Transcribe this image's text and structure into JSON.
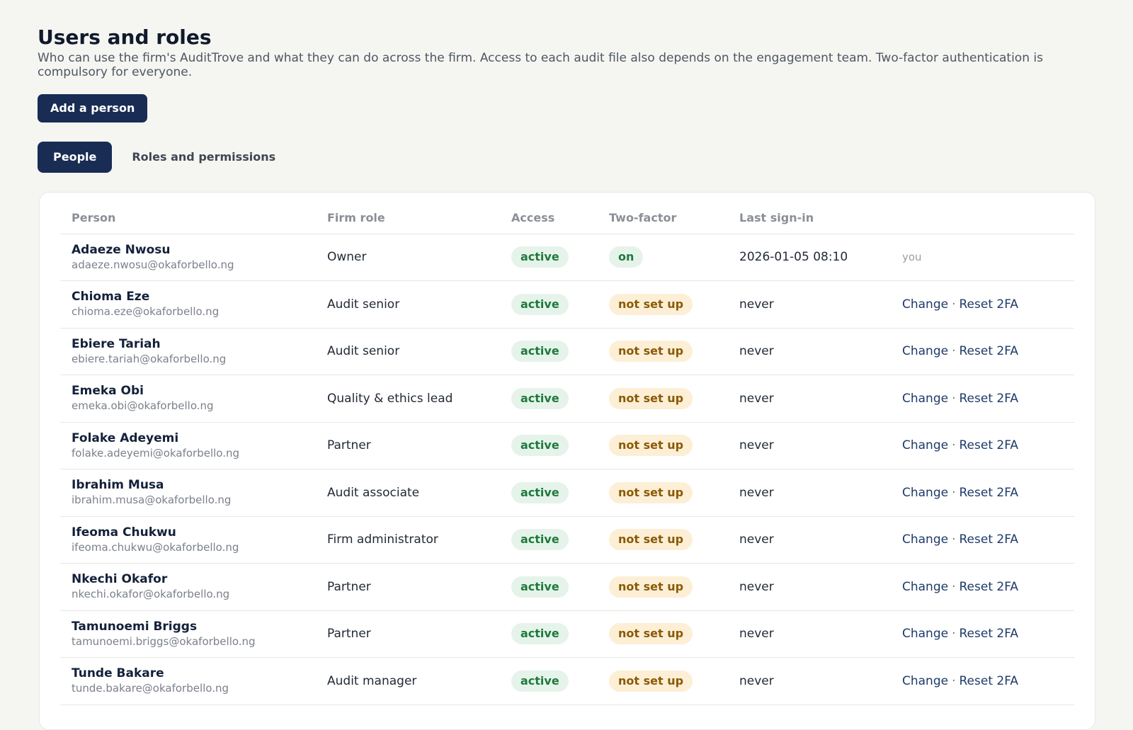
{
  "header": {
    "title": "Users and roles",
    "description": "Who can use the firm's AuditTrove and what they can do across the firm. Access to each audit file also depends on the engagement team. Two-factor authentication is compulsory for everyone.",
    "add_button": "Add a person"
  },
  "tabs": [
    {
      "label": "People",
      "active": true
    },
    {
      "label": "Roles and permissions",
      "active": false
    }
  ],
  "table": {
    "columns": [
      "Person",
      "Firm role",
      "Access",
      "Two-factor",
      "Last sign-in"
    ],
    "action_labels": {
      "change": "Change",
      "separator": "·",
      "reset": "Reset 2FA"
    },
    "rows": [
      {
        "name": "Adaeze Nwosu",
        "email": "adaeze.nwosu@okaforbello.ng",
        "role": "Owner",
        "access": "active",
        "two_factor": "on",
        "last_sign_in": "2026-01-05 08:10",
        "self_label": "you"
      },
      {
        "name": "Chioma Eze",
        "email": "chioma.eze@okaforbello.ng",
        "role": "Audit senior",
        "access": "active",
        "two_factor": "not set up",
        "last_sign_in": "never"
      },
      {
        "name": "Ebiere Tariah",
        "email": "ebiere.tariah@okaforbello.ng",
        "role": "Audit senior",
        "access": "active",
        "two_factor": "not set up",
        "last_sign_in": "never"
      },
      {
        "name": "Emeka Obi",
        "email": "emeka.obi@okaforbello.ng",
        "role": "Quality & ethics lead",
        "access": "active",
        "two_factor": "not set up",
        "last_sign_in": "never"
      },
      {
        "name": "Folake Adeyemi",
        "email": "folake.adeyemi@okaforbello.ng",
        "role": "Partner",
        "access": "active",
        "two_factor": "not set up",
        "last_sign_in": "never"
      },
      {
        "name": "Ibrahim Musa",
        "email": "ibrahim.musa@okaforbello.ng",
        "role": "Audit associate",
        "access": "active",
        "two_factor": "not set up",
        "last_sign_in": "never"
      },
      {
        "name": "Ifeoma Chukwu",
        "email": "ifeoma.chukwu@okaforbello.ng",
        "role": "Firm administrator",
        "access": "active",
        "two_factor": "not set up",
        "last_sign_in": "never"
      },
      {
        "name": "Nkechi Okafor",
        "email": "nkechi.okafor@okaforbello.ng",
        "role": "Partner",
        "access": "active",
        "two_factor": "not set up",
        "last_sign_in": "never"
      },
      {
        "name": "Tamunoemi Briggs",
        "email": "tamunoemi.briggs@okaforbello.ng",
        "role": "Partner",
        "access": "active",
        "two_factor": "not set up",
        "last_sign_in": "never"
      },
      {
        "name": "Tunde Bakare",
        "email": "tunde.bakare@okaforbello.ng",
        "role": "Audit manager",
        "access": "active",
        "two_factor": "not set up",
        "last_sign_in": "never"
      }
    ]
  },
  "colors": {
    "primary": "#192c54",
    "status_active_bg": "#e6f3ea",
    "status_active_text": "#1d7a3c",
    "status_pending_bg": "#fcefd6",
    "status_pending_text": "#8a5a06",
    "link": "#1e3a68",
    "background": "#f5f6f1"
  }
}
